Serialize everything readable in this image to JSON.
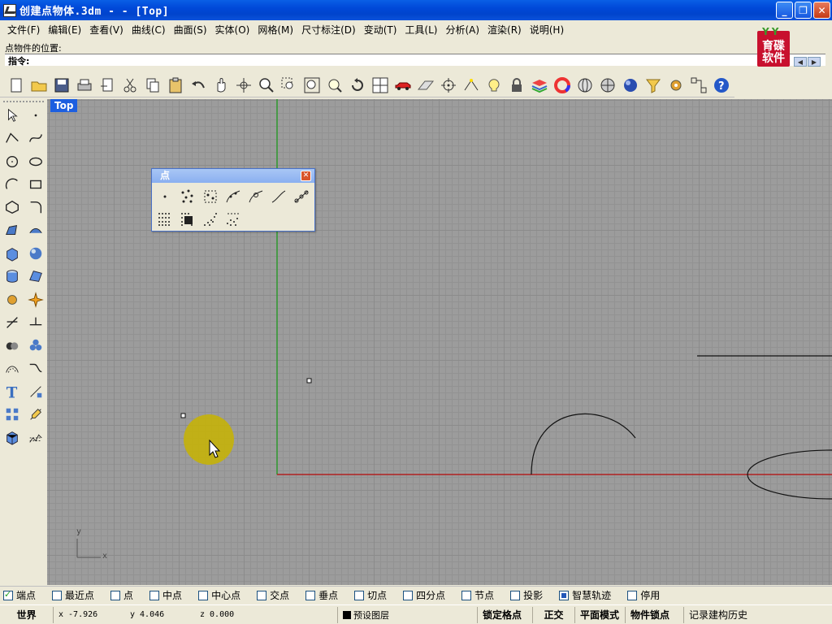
{
  "window": {
    "title": "创建点物体.3dm -  - [Top]"
  },
  "menu": [
    "文件(F)",
    "编辑(E)",
    "查看(V)",
    "曲线(C)",
    "曲面(S)",
    "实体(O)",
    "网格(M)",
    "尺寸标注(D)",
    "变动(T)",
    "工具(L)",
    "分析(A)",
    "渲染(R)",
    "说明(H)"
  ],
  "command": {
    "history": "点物件的位置:",
    "prompt": "指令:"
  },
  "logo": {
    "text": "育碟软件"
  },
  "toolbar": {
    "icons": [
      "new-icon",
      "open-icon",
      "save-icon",
      "print-icon",
      "import-icon",
      "cut-icon",
      "copy-icon",
      "paste-icon",
      "undo-icon",
      "pan-icon",
      "rotate-view-icon",
      "zoom-icon",
      "zoom-window-icon",
      "zoom-extents-icon",
      "zoom-selected-icon",
      "undo-view-icon",
      "four-viewports-icon",
      "car-icon",
      "grid-plane-icon",
      "cplane-icon",
      "snap-icon",
      "light-icon",
      "lock-icon",
      "layer-icon",
      "color-wheel-icon",
      "wireframe-sphere-icon",
      "rendered-sphere-icon",
      "shaded-sphere-icon",
      "select-filter-icon",
      "options-gear-icon",
      "group-icon",
      "help-icon"
    ]
  },
  "viewport": {
    "label": "Top",
    "axis_x": "x",
    "axis_y": "y"
  },
  "points_panel": {
    "title": "点",
    "tools": [
      "single-point-icon",
      "multiple-points-icon",
      "point-cloud-icon",
      "divide-curve-length-icon",
      "divide-curve-count-icon",
      "closest-point-icon",
      "extract-points-icon",
      "point-grid-icon",
      "mark-points-icon",
      "scatter-points-icon",
      "drape-points-icon"
    ]
  },
  "osnap": [
    {
      "label": "端点",
      "checked": true
    },
    {
      "label": "最近点",
      "checked": false
    },
    {
      "label": "点",
      "checked": false
    },
    {
      "label": "中点",
      "checked": false
    },
    {
      "label": "中心点",
      "checked": false
    },
    {
      "label": "交点",
      "checked": false
    },
    {
      "label": "垂点",
      "checked": false
    },
    {
      "label": "切点",
      "checked": false
    },
    {
      "label": "四分点",
      "checked": false
    },
    {
      "label": "节点",
      "checked": false
    },
    {
      "label": "投影",
      "checked": false
    },
    {
      "label": "智慧轨迹",
      "checked": true
    },
    {
      "label": "停用",
      "checked": false
    }
  ],
  "status": {
    "cplane": "世界",
    "x": "x -7.926",
    "y": "y 4.046",
    "z": "z 0.000",
    "layer": "预设图层",
    "grid_snap": "锁定格点",
    "ortho": "正交",
    "planar": "平面模式",
    "osnap": "物件锁点",
    "history": "记录建构历史"
  }
}
